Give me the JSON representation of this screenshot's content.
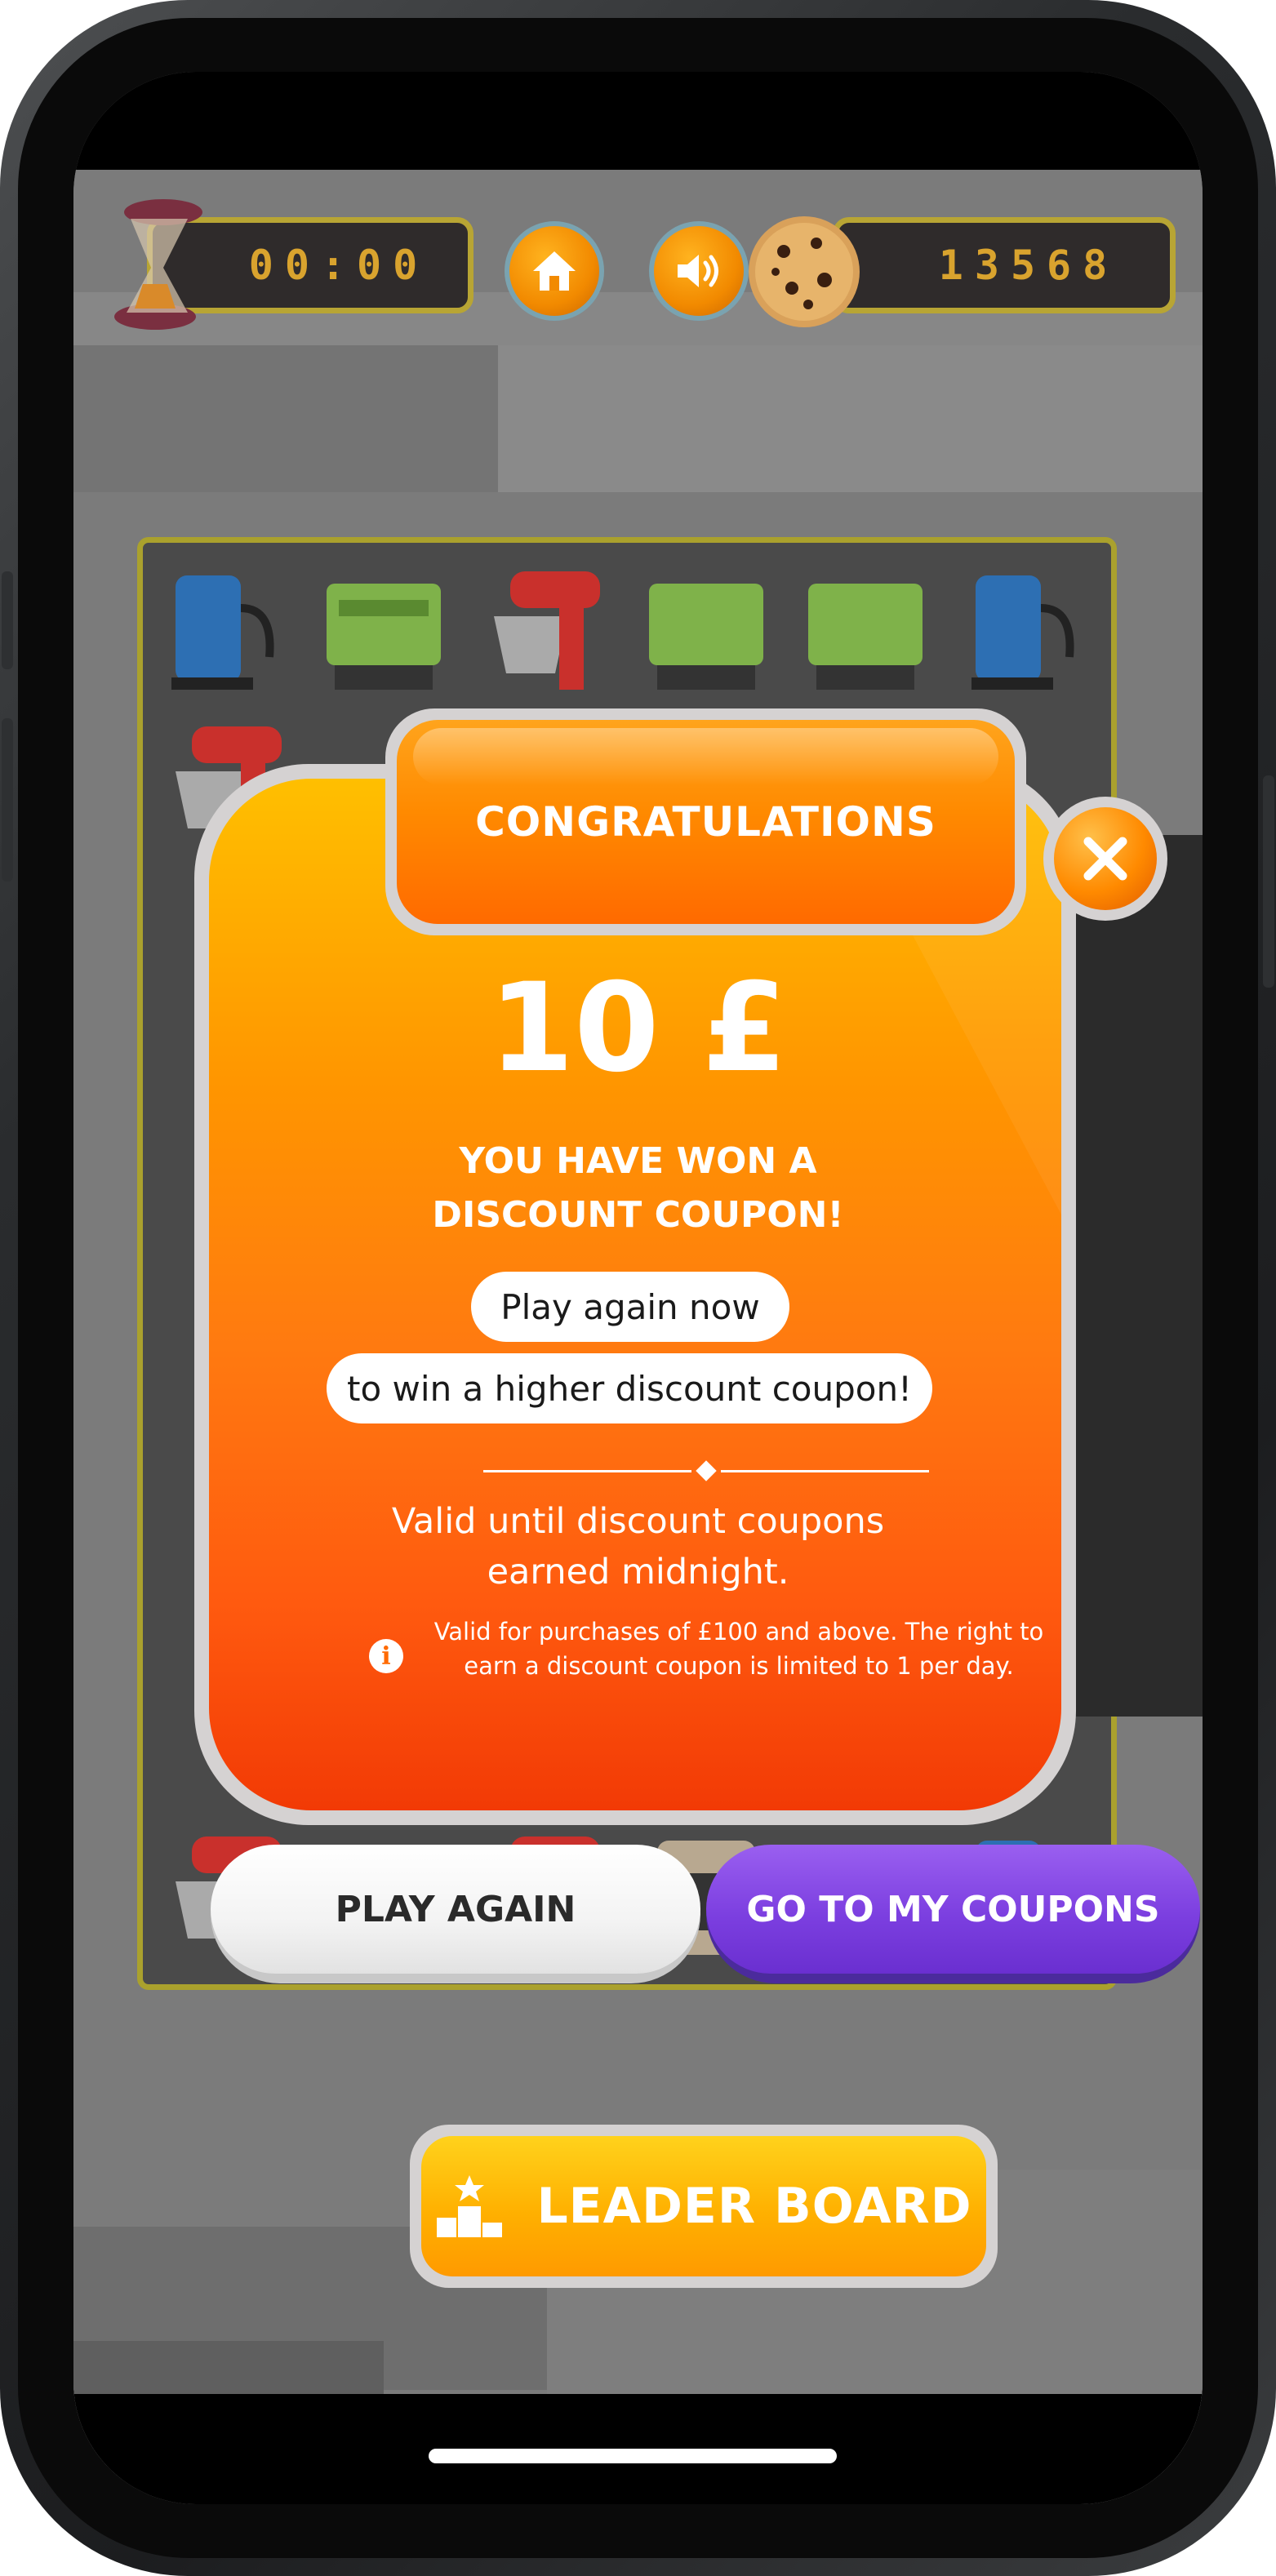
{
  "hud": {
    "timer": "00:00",
    "score": "13568"
  },
  "modal": {
    "title": "CONGRATULATIONS",
    "prize": "10 £",
    "won_line1": "YOU HAVE WON A",
    "won_line2": "DISCOUNT COUPON!",
    "pill1": "Play again now",
    "pill2": "to win a higher discount coupon!",
    "valid_line1": "Valid until discount coupons",
    "valid_line2": "earned midnight.",
    "terms_line1": "Valid for purchases of £100 and above. The right to",
    "terms_line2": "earn a discount coupon is limited to 1 per day."
  },
  "buttons": {
    "play_again": "PLAY AGAIN",
    "my_coupons": "GO TO MY COUPONS",
    "leader_board": "LEADER BOARD"
  },
  "colors": {
    "accent_orange": "#ff8a00",
    "accent_purple": "#7c3fe0",
    "accent_yellow": "#ffb000"
  },
  "icons": [
    "hourglass-icon",
    "home-icon",
    "sound-icon",
    "cookie-icon",
    "close-icon",
    "info-icon",
    "podium-icon"
  ]
}
